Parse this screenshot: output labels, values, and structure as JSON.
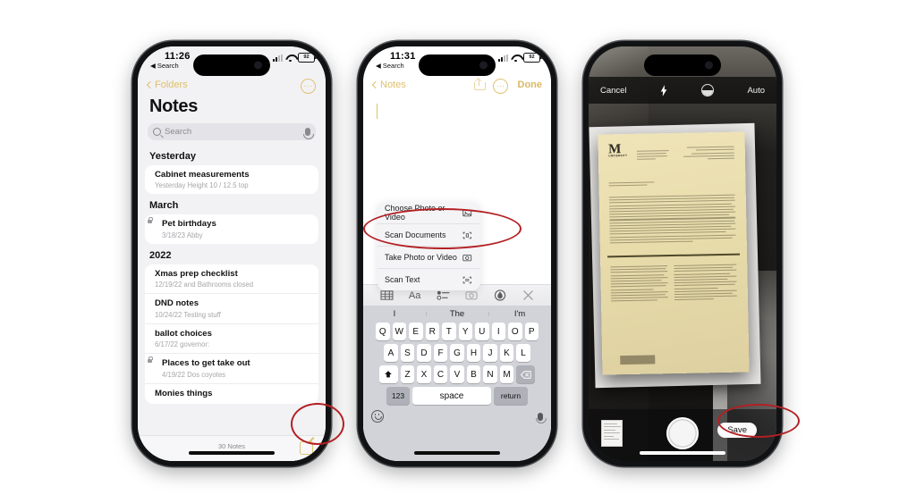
{
  "tutorial": {
    "background_color": "#ffffff",
    "annotation_color": "#b32024"
  },
  "phone1": {
    "name": "Notes app list screen",
    "status": {
      "time": "11:26",
      "back_label": "Search",
      "battery": "92"
    },
    "nav": {
      "back_label": "Folders",
      "more_label": "···"
    },
    "title": "Notes",
    "search": {
      "placeholder": "Search"
    },
    "sections": [
      {
        "heading": "Yesterday",
        "notes": [
          {
            "title": "Cabinet measurements",
            "subtitle": "Yesterday   Height 10 / 12.5 top",
            "locked": false
          }
        ]
      },
      {
        "heading": "March",
        "notes": [
          {
            "title": "Pet birthdays",
            "subtitle": "3/18/23   Abby",
            "locked": true
          }
        ]
      },
      {
        "heading": "2022",
        "notes": [
          {
            "title": "Xmas prep checklist",
            "subtitle": "12/19/22   and Bathrooms closed",
            "locked": false
          },
          {
            "title": "DND notes",
            "subtitle": "10/24/22   Testing stuff",
            "locked": false
          },
          {
            "title": "ballot choices",
            "subtitle": "6/17/22   governor:",
            "locked": false
          },
          {
            "title": "Places to get take out",
            "subtitle": "4/19/22   Dos coyotes",
            "locked": true
          },
          {
            "title": "Monies things",
            "subtitle": "",
            "locked": false
          }
        ]
      }
    ],
    "footer": {
      "count_label": "30 Notes",
      "compose_icon": "compose-icon"
    }
  },
  "phone2": {
    "name": "New note with attachment menu open",
    "status": {
      "time": "11:31",
      "back_label": "Search",
      "battery": "92"
    },
    "nav": {
      "back_label": "Notes",
      "share_icon": "share-icon",
      "more_label": "···",
      "done_label": "Done"
    },
    "attachment_menu": [
      {
        "label": "Choose Photo or Video",
        "icon": "photo-library-icon"
      },
      {
        "label": "Scan Documents",
        "icon": "scan-documents-icon",
        "highlighted": true
      },
      {
        "label": "Take Photo or Video",
        "icon": "camera-icon"
      },
      {
        "label": "Scan Text",
        "icon": "scan-text-icon"
      }
    ],
    "format_toolbar": [
      {
        "icon": "table-icon",
        "label": ""
      },
      {
        "icon": "text-format-icon",
        "label": "Aa"
      },
      {
        "icon": "checklist-icon",
        "label": ""
      },
      {
        "icon": "camera-icon",
        "label": ""
      },
      {
        "icon": "markup-pen-icon",
        "label": ""
      },
      {
        "icon": "close-icon",
        "label": ""
      }
    ],
    "keyboard": {
      "predictions": [
        "I",
        "The",
        "I'm"
      ],
      "row1": [
        "Q",
        "W",
        "E",
        "R",
        "T",
        "Y",
        "U",
        "I",
        "O",
        "P"
      ],
      "row2": [
        "A",
        "S",
        "D",
        "F",
        "G",
        "H",
        "J",
        "K",
        "L"
      ],
      "row3": [
        "Z",
        "X",
        "C",
        "V",
        "B",
        "N",
        "M"
      ],
      "shift_icon": "shift-icon",
      "delete_icon": "delete-icon",
      "numbers_label": "123",
      "space_label": "space",
      "return_label": "return",
      "emoji_icon": "emoji-icon",
      "dictation_icon": "microphone-icon"
    }
  },
  "phone3": {
    "name": "Document scanner camera view",
    "top_bar": {
      "cancel_label": "Cancel",
      "flash_icon": "flash-icon",
      "filter_icon": "color-filter-icon",
      "mode_label": "Auto"
    },
    "bottom_bar": {
      "thumbnail_icon": "scan-thumbnail",
      "shutter_icon": "shutter-button",
      "save_label": "Save"
    },
    "document": {
      "logo_text": "M",
      "logo_sub": "UNIVERSITY"
    }
  }
}
